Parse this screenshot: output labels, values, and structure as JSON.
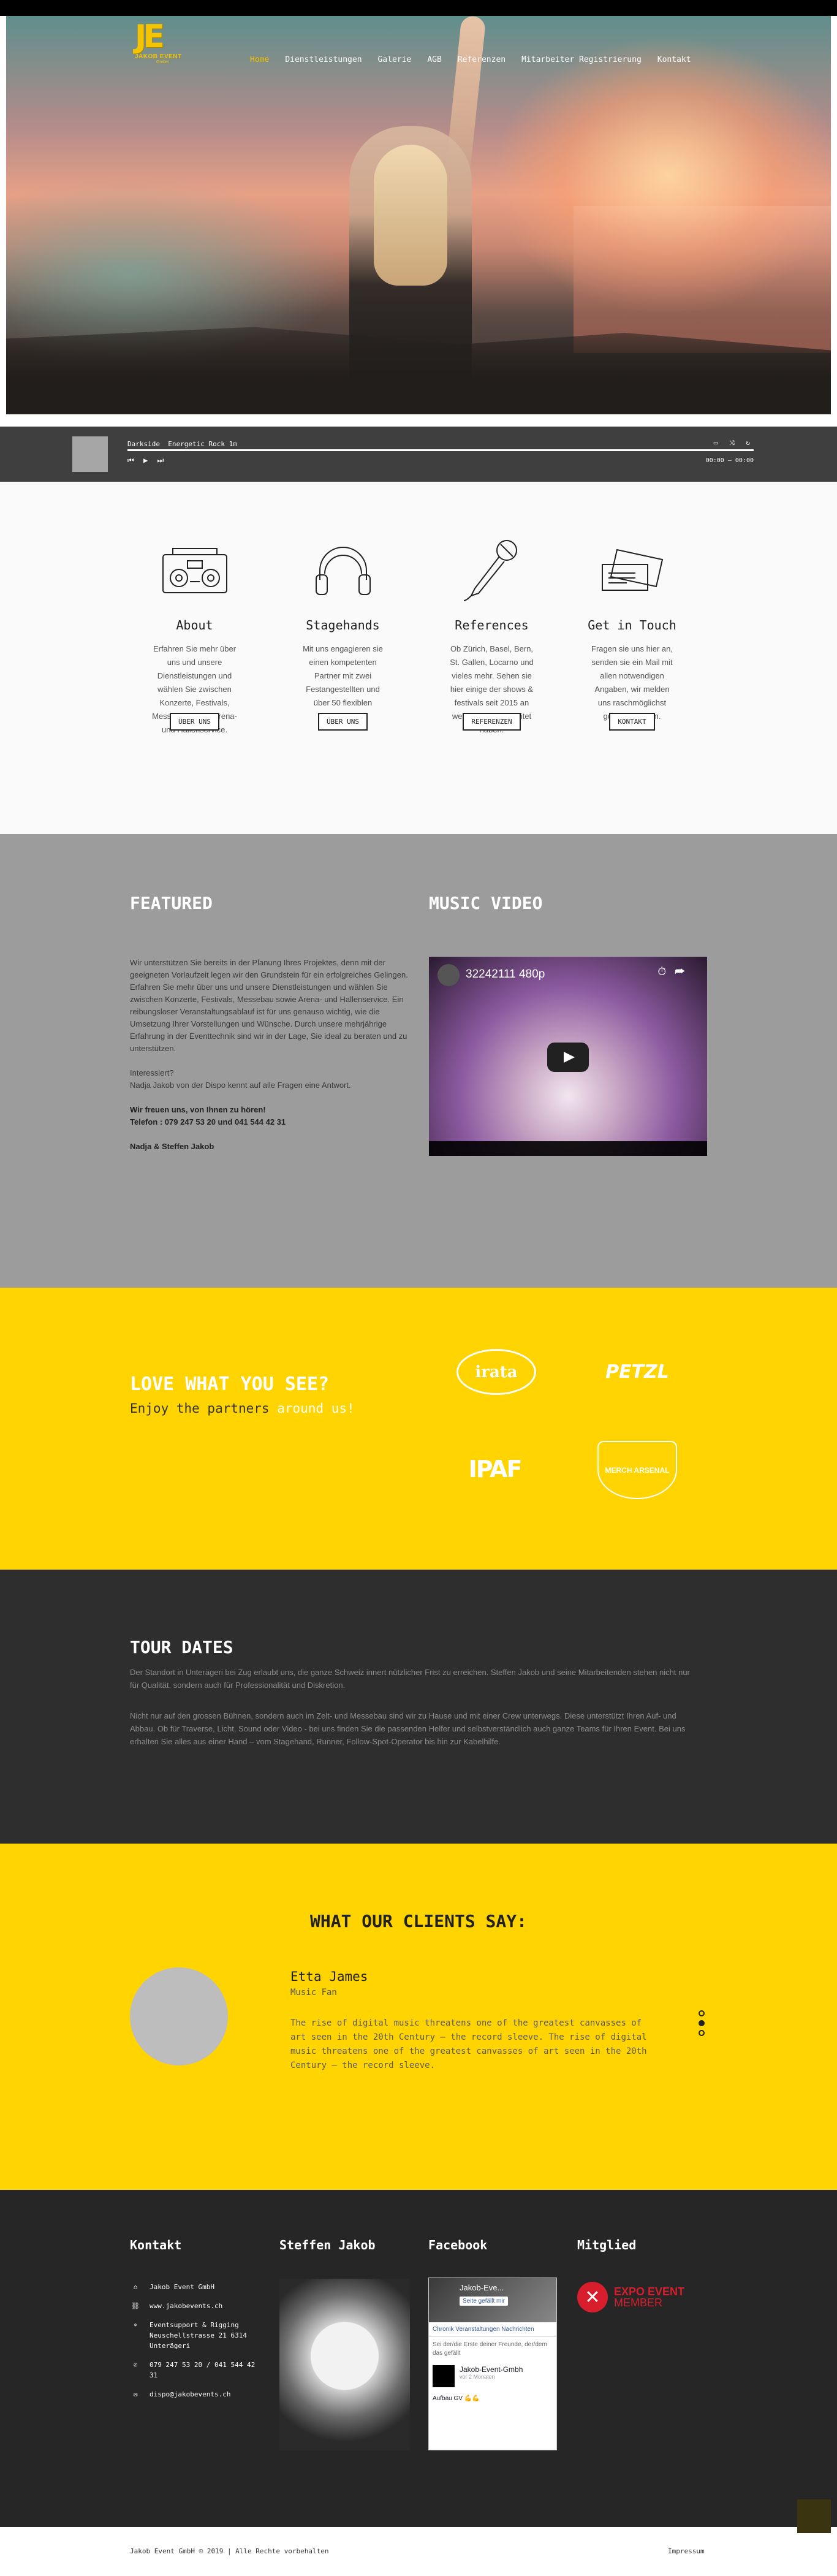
{
  "header": {
    "logo_mark": "JE",
    "logo_brand": "JAKOB EVENT",
    "logo_sub": "GmbH",
    "menu": [
      {
        "label": "Home",
        "active": true
      },
      {
        "label": "Dienstleistungen"
      },
      {
        "label": "Galerie"
      },
      {
        "label": "AGB"
      },
      {
        "label": "Referenzen"
      },
      {
        "label": "Mitarbeiter Registrierung"
      },
      {
        "label": "Kontakt"
      }
    ]
  },
  "player": {
    "track_artist": "Darkside",
    "track_title": "Energetic Rock 1m",
    "time": "00:00 – 00:00",
    "controls": "⏮ ▶ ⏭",
    "right_icons": "▭ ⤨ ↻"
  },
  "services": [
    {
      "icon": "boombox-icon",
      "title": "About",
      "text": "Erfahren Sie mehr über uns und unsere Dienstleistungen und wählen Sie zwischen Konzerte, Festivals, Messebau sowie Arena- und Hallenservice.",
      "button": "Über uns"
    },
    {
      "icon": "headphones-icon",
      "title": "Stagehands",
      "text": "Mit uns engagieren sie einen kompetenten Partner mit zwei Festangestellten und über 50 flexiblen Freelancern.",
      "button": "Über uns"
    },
    {
      "icon": "microphone-icon",
      "title": "References",
      "text": "Ob Zürich, Basel, Bern, St. Gallen, Locarno und vieles mehr. Sehen sie hier einige der shows & festivals seit 2015 an welchen wir gearbeitet haben.",
      "button": "Referenzen"
    },
    {
      "icon": "tickets-icon",
      "title": "Get in Touch",
      "text": "Fragen sie uns hier an, senden sie ein Mail mit allen notwendigen Angaben, wir melden uns raschmöglichst gerne bei Ihnen.",
      "button": "Kontakt"
    }
  ],
  "featured": {
    "title": "FEATURED",
    "video_title": "MUSIC VIDEO",
    "p1": "Wir unterstützen Sie bereits in der Planung Ihres Projektes, denn mit der geeigneten Vorlaufzeit legen wir den Grundstein für ein erfolgreiches Gelingen. Erfahren Sie mehr über uns und unsere Dienstleistungen und wählen Sie zwischen Konzerte, Festivals, Messebau sowie Arena- und Hallenservice. Ein reibungsloser Veranstaltungsablauf ist für uns genauso wichtig, wie die Umsetzung Ihrer Vorstellungen und Wünsche. Durch unsere mehrjährige Erfahrung in der Eventtechnik sind wir in der Lage, Sie ideal zu beraten und zu unterstützen.",
    "p2a": "Interessiert?",
    "p2b": "Nadja Jakob von der Dispo kennt auf alle Fragen eine Antwort.",
    "p3a": "Wir freuen uns, von Ihnen zu hören!",
    "p3b": "Telefon : 079 247 53 20 und 041 544 42 31",
    "p4": "Nadja & Steffen Jakob",
    "yt_title": "32242111 480p"
  },
  "partners": {
    "title": "LOVE WHAT YOU SEE?",
    "tag_prefix": "Enjoy the partners ",
    "tag_highlight": "around us!",
    "logos": [
      "irata",
      "PETZL",
      "IPAF",
      "MERCH ARSENAL"
    ]
  },
  "tour": {
    "title": "TOUR DATES",
    "p1": "Der Standort in Unterägeri bei Zug erlaubt uns, die ganze Schweiz innert nützlicher Frist zu erreichen. Steffen Jakob und seine Mitarbeitenden stehen nicht nur für Qualität, sondern auch für Professionalität und Diskretion.",
    "p2": "Nicht nur auf den grossen Bühnen, sondern auch im Zelt- und Messebau sind wir zu Hause und mit einer Crew unterwegs. Diese unterstützt Ihren Auf- und Abbau. Ob für Traverse, Licht, Sound oder Video - bei uns finden Sie die passenden Helfer und selbstverständlich auch ganze Teams für Ihren Event. Bei uns erhalten Sie alles aus einer Hand – vom Stagehand, Runner, Follow-Spot-Operator bis hin zur Kabelhilfe."
  },
  "clients": {
    "title": "WHAT OUR CLIENTS SAY:",
    "name": "Etta James",
    "role": "Music Fan",
    "quote": "The rise of digital music threatens one of the greatest canvasses of art seen in the 20th Century – the record sleeve. The rise of digital music threatens one of the greatest canvasses of art seen in the 20th Century – the record sleeve."
  },
  "footer": {
    "col1": "Kontakt",
    "col2": "Steffen Jakob",
    "col3": "Facebook",
    "col4": "Mitglied",
    "contact": [
      {
        "icon": "home-icon",
        "glyph": "⌂",
        "text": "Jakob Event GmbH"
      },
      {
        "icon": "link-icon",
        "glyph": "⛓",
        "text": "www.jakobevents.ch"
      },
      {
        "icon": "location-icon",
        "glyph": "⌖",
        "text": "Eventsupport & Rigging Neuschellstrasse 21 6314 Unterägeri"
      },
      {
        "icon": "phone-icon",
        "glyph": "✆",
        "text": "079 247 53 20 / 041 544 42 31"
      },
      {
        "icon": "mail-icon",
        "glyph": "✉",
        "text": "dispo@jakobevents.ch"
      }
    ],
    "fb_name": "Jakob-Eve...",
    "fb_like": "Seite gefällt mir",
    "fb_tabs": "Chronik   Veranstaltungen   Nachrichten",
    "fb_post": "Sei der/die Erste deiner Freunde, der/dem das gefällt",
    "fb_company": "Jakob-Event-Gmbh",
    "fb_time": "vor 2 Monaten",
    "fb_text": "Aufbau GV 💪💪",
    "expo_1": "EXPO EVENT",
    "expo_2": "MEMBER"
  },
  "bottom": {
    "copyright": "Jakob Event GmbH © 2019 | Alle Rechte vorbehalten",
    "impressum": "Impressum"
  }
}
